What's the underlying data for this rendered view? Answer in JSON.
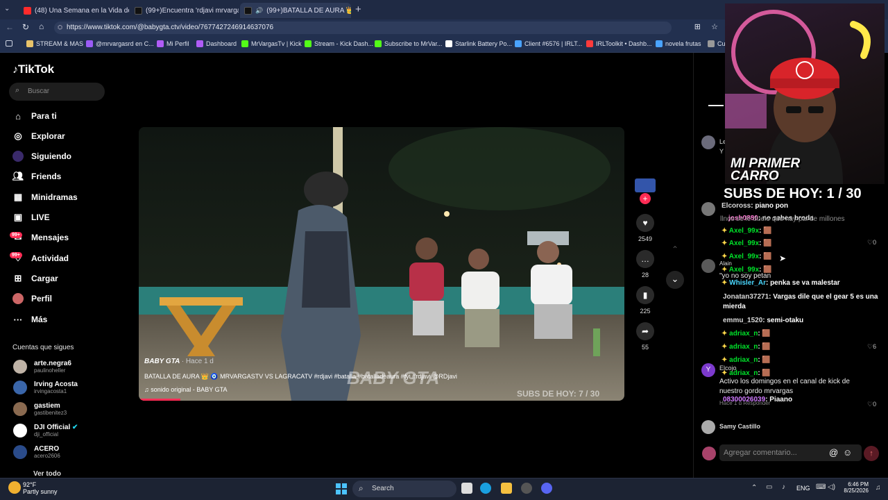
{
  "browser": {
    "tabs": [
      {
        "label": "(48) Una Semana en la Vida de M",
        "color": "#ff3b3b"
      },
      {
        "label": "(99+)Encuentra 'rdjavi mrvargas' e",
        "color": "#ffffff"
      },
      {
        "label": "(99+)BATALLA DE AURA 👑 🧿 (",
        "color": "#ffffff"
      }
    ],
    "url": "https://www.tiktok.com/@babygta.ctv/video/7677427246914637076",
    "bookmarks": [
      "STREAM & MAS",
      "@mrvargasrd en C...",
      "Mi Perfil",
      "Dashboard",
      "MrVargasTv | Kick",
      "Stream - Kick Dash...",
      "Subscribe to MrVar...",
      "Starlink Battery Po...",
      "Client #6576 | IRLT...",
      "IRLToolkit • Dashb...",
      "novela frutas",
      "Cu"
    ]
  },
  "tiktok": {
    "logo": "TikTok",
    "search_placeholder": "Buscar",
    "nav": [
      {
        "label": "Para ti",
        "icon": "home-icon"
      },
      {
        "label": "Explorar",
        "icon": "compass-icon"
      },
      {
        "label": "Siguiendo",
        "icon": "following-icon"
      },
      {
        "label": "Friends",
        "icon": "friends-icon"
      },
      {
        "label": "Minidramas",
        "icon": "minidramas-icon"
      },
      {
        "label": "LIVE",
        "icon": "live-icon"
      },
      {
        "label": "Mensajes",
        "icon": "messages-icon",
        "badge": "99+"
      },
      {
        "label": "Actividad",
        "icon": "activity-icon",
        "badge": "99+"
      },
      {
        "label": "Cargar",
        "icon": "upload-icon"
      },
      {
        "label": "Perfil",
        "icon": "profile-icon"
      },
      {
        "label": "Más",
        "icon": "more-icon"
      }
    ],
    "following_header": "Cuentas que sigues",
    "following": [
      {
        "name": "arte.negra6",
        "handle": "paulinoheller"
      },
      {
        "name": "Irving Acosta",
        "handle": "irvingacosta1"
      },
      {
        "name": "gastiem",
        "handle": "gastibenitez3"
      },
      {
        "name": "DJI Official",
        "handle": "dji_official"
      },
      {
        "name": "ACERO",
        "handle": "acero2606"
      }
    ],
    "see_all": "Ver todo",
    "video": {
      "author": "BABY GTA",
      "time": "Hace 1 d",
      "caption": "BATALLA DE AURA 👑 🧿 MRVARGASTV VS LAGRACATV #rdjavi #batalla #batalladeaura #fyi #rdjavi @RDjavi",
      "sound": "sonido original - BABY GTA",
      "watermark": "BABY GTA",
      "overlay_subs": "SUBS DE HOY: 7 / 30"
    },
    "actions": {
      "likes": "2549",
      "comments": "28",
      "saves": "225",
      "shares": "55"
    },
    "comments": [
      {
        "name": "Le",
        "text": "Y"
      },
      {
        "name": "",
        "text": ""
      },
      {
        "name": "Alain",
        "text": "\"yo no soy petan"
      },
      {
        "name": "Elcojo",
        "text": "Activo los domingos en el canal de kick de nuestro gordo mrvargas"
      },
      {
        "name": "Samy Castillo",
        "text": ""
      }
    ],
    "comment_meta": {
      "reply": "Responder",
      "time": "Hace 1 d",
      "likes": [
        "0",
        "6",
        "0"
      ]
    },
    "comment_placeholder": "Agregar comentario..."
  },
  "overlay": {
    "banner": "MI PRIMER CARRO",
    "subs": "SUBS DE HOY: 1 / 30",
    "chat": [
      {
        "user": "Elcoross",
        "text": ": piano pon"
      },
      {
        "user": "josh0880",
        "text": ": no sabes broda"
      },
      {
        "user": "Axel_99x",
        "text": ": 🟫"
      },
      {
        "user": "Axel_99x",
        "text": ": 🟫"
      },
      {
        "user": "Axel_99x",
        "text": ": 🟫"
      },
      {
        "user": "Axel_99x",
        "text": ": 🟫"
      },
      {
        "user": "Whisler_Ar",
        "text": ": penka se va malestar"
      },
      {
        "user": "Jonatan37271",
        "text": ": Vargas dile que el gear 5 es una mierda"
      },
      {
        "user": "emmu_1520",
        "text": ": semi-otaku"
      },
      {
        "user": "adriax_n",
        "text": ": 🟫"
      },
      {
        "user": "adriax_n",
        "text": ": 🟫"
      },
      {
        "user": "adriax_n",
        "text": ": 🟫"
      },
      {
        "user": "adriax_n",
        "text": ": 🟫"
      },
      {
        "user": "08300026039",
        "text": ": Piaano"
      }
    ],
    "comment_bleed": "llnos se le duele que hay pal de millones"
  },
  "taskbar": {
    "weather_temp": "92°F",
    "weather_desc": "Partly sunny",
    "search": "Search",
    "lang": "ENG",
    "time": "6:46 PM",
    "date": "8/25/2026"
  }
}
